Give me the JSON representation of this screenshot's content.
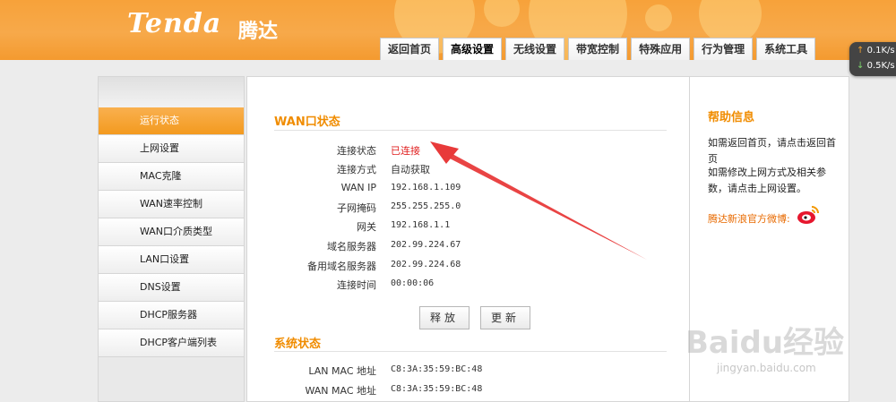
{
  "header": {
    "logo": "Tenda",
    "logo_cn": "腾达",
    "tabs": [
      "返回首页",
      "高级设置",
      "无线设置",
      "带宽控制",
      "特殊应用",
      "行为管理",
      "系统工具"
    ],
    "active_tab": "高级设置"
  },
  "speed": {
    "up": "0.1K/s",
    "down": "0.5K/s"
  },
  "sidebar": {
    "items": [
      "运行状态",
      "上网设置",
      "MAC克隆",
      "WAN速率控制",
      "WAN口介质类型",
      "LAN口设置",
      "DNS设置",
      "DHCP服务器",
      "DHCP客户端列表"
    ],
    "active": "运行状态"
  },
  "wan": {
    "title": "WAN口状态",
    "rows": [
      {
        "label": "连接状态",
        "value": "已连接"
      },
      {
        "label": "连接方式",
        "value": "自动获取"
      },
      {
        "label": "WAN IP",
        "value": "192.168.1.109"
      },
      {
        "label": "子网掩码",
        "value": "255.255.255.0"
      },
      {
        "label": "网关",
        "value": "192.168.1.1"
      },
      {
        "label": "域名服务器",
        "value": "202.99.224.67"
      },
      {
        "label": "备用域名服务器",
        "value": "202.99.224.68"
      },
      {
        "label": "连接时间",
        "value": "00:00:06"
      }
    ],
    "release_label": "释放",
    "refresh_label": "更新"
  },
  "system": {
    "title": "系统状态",
    "rows": [
      {
        "label": "LAN MAC 地址",
        "value": "C8:3A:35:59:BC:48"
      },
      {
        "label": "WAN MAC 地址",
        "value": "C8:3A:35:59:BC:48"
      }
    ]
  },
  "help": {
    "title": "帮助信息",
    "line1": "如需返回首页，请点击返回首页",
    "line2": "如需修改上网方式及相关参数，请点击上网设置。",
    "weibo": "腾达新浪官方微博:"
  },
  "watermark": {
    "main": "Baidu经验",
    "sub": "jingyan.baidu.com"
  },
  "colors": {
    "accent": "#f7a23a",
    "title": "#f08c00",
    "connected": "#e02020",
    "arrow": "#e83a3a"
  }
}
